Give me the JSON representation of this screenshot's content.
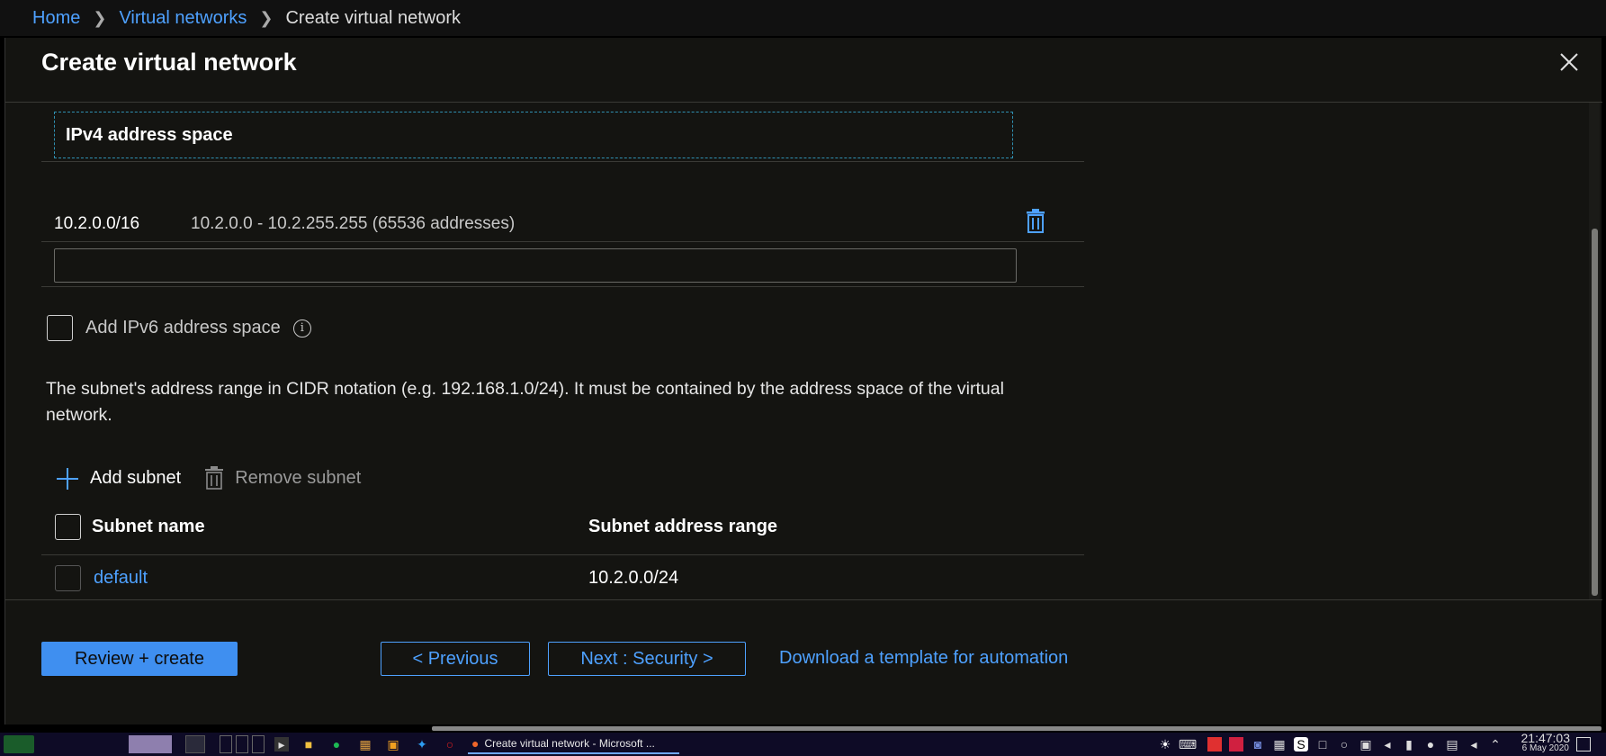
{
  "breadcrumb": {
    "home": "Home",
    "virtual_networks": "Virtual networks",
    "current": "Create virtual network"
  },
  "panel": {
    "title": "Create virtual network"
  },
  "address_space": {
    "header": "IPv4 address space",
    "rows": [
      {
        "cidr": "10.2.0.0/16",
        "range": "10.2.0.0 - 10.2.255.255 (65536 addresses)"
      }
    ],
    "new_input_value": ""
  },
  "ipv6": {
    "label": "Add IPv6 address space",
    "checked": false
  },
  "description": "The subnet's address range in CIDR notation (e.g. 192.168.1.0/24). It must be contained by the address space of the virtual network.",
  "subnet_toolbar": {
    "add_label": "Add subnet",
    "remove_label": "Remove subnet"
  },
  "subnet_table": {
    "columns": [
      "Subnet name",
      "Subnet address range"
    ],
    "rows": [
      {
        "name": "default",
        "range": "10.2.0.0/24"
      }
    ]
  },
  "footer": {
    "review_label": "Review + create",
    "previous_label": "< Previous",
    "next_label": "Next : Security >",
    "download_label": "Download a template for automation"
  },
  "taskbar": {
    "active_task": "Create virtual network - Microsoft ...",
    "time": "21:47:03",
    "date": "6 May 2020"
  },
  "colors": {
    "accent": "#4ea1ff",
    "primary_button": "#3f8ff0",
    "panel_bg": "#141411"
  }
}
